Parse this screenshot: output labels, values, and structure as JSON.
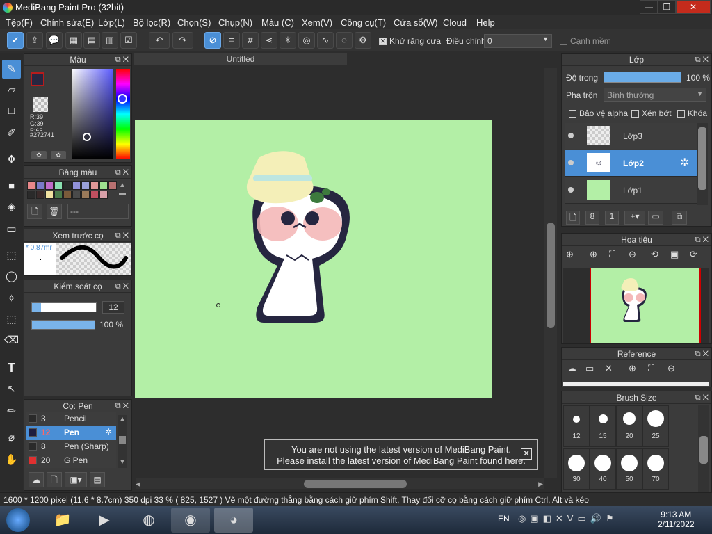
{
  "app": {
    "title": "MediBang Paint Pro (32bit)",
    "win_min": "—",
    "win_max": "❐",
    "win_close": "✕"
  },
  "menu": [
    "Tệp(F)",
    "Chỉnh sửa(E)",
    "Lớp(L)",
    "Bộ lọc(R)",
    "Chọn(S)",
    "Chụp(N)",
    "Màu (C)",
    "Xem(V)",
    "Công cụ(T)",
    "Cửa sổ(W)",
    "Cloud",
    "Help"
  ],
  "toolbar": {
    "antialias": "Khử răng cưa",
    "adjust": "Điều chỉnh",
    "adjust_value": "0",
    "soft_edge": "Cạnh mềm"
  },
  "color_panel": {
    "title": "Màu",
    "r": "R:39",
    "g": "G:39",
    "b": "B:65",
    "hex": "#272741",
    "fg": "#b71c1c",
    "bg": "#4040aa"
  },
  "palette_panel": {
    "title": "Bảng màu",
    "name": "---",
    "colors": [
      "#e8888a",
      "#7a7ac8",
      "#c06cc8",
      "#8ae0b0",
      "#2a2a2a",
      "#9090d8",
      "#9aa0d8",
      "#e09898",
      "#a0e090",
      "#b87070",
      "#2a2a2a",
      "#3a2a2a",
      "#f0e0a0",
      "#4a7a4a",
      "#7a5a3a",
      "#4a4a4a",
      "#9a7a5a",
      "#c05060",
      "#d8a0a8"
    ]
  },
  "preview_panel": {
    "title": "Xem trước cọ",
    "size": "* 0.87mr"
  },
  "brush_ctrl": {
    "title": "Kiểm soát cọ",
    "size": "12",
    "opacity": "100 %",
    "size_level": 0.14,
    "opacity_level": 1.0
  },
  "brush_panel": {
    "title": "Cọ: Pen",
    "items": [
      {
        "size": "3",
        "name": "Pencil",
        "color": "#2a2a2a"
      },
      {
        "size": "12",
        "name": "Pen",
        "color": "#1e1e40"
      },
      {
        "size": "8",
        "name": "Pen (Sharp)",
        "color": "#2a2a2a"
      },
      {
        "size": "20",
        "name": "G Pen",
        "color": "#e03030"
      }
    ]
  },
  "canvas": {
    "tab": "Untitled"
  },
  "notice": {
    "line1": "You are not using the latest version of MediBang Paint.",
    "line2": "Please install the latest version of MediBang Paint found here."
  },
  "layer_panel": {
    "title": "Lớp",
    "opacity_label": "Độ trong",
    "opacity": "100 %",
    "blend_label": "Pha trộn",
    "blend": "Bình thường",
    "protect_alpha": "Bảo vệ alpha",
    "clip": "Xén bớt",
    "lock": "Khóa",
    "layers": [
      "Lớp3",
      "Lớp2",
      "Lớp1"
    ]
  },
  "nav_panel": {
    "title": "Hoa tiêu"
  },
  "ref_panel": {
    "title": "Reference"
  },
  "brushsize_panel": {
    "title": "Brush Size",
    "sizes": [
      "12",
      "15",
      "20",
      "25",
      "30",
      "40",
      "50",
      "70"
    ]
  },
  "status": "1600 * 1200 pixel  (11.6 * 8.7cm)  350 dpi  33 %  ( 825, 1527 )  Vẽ một đường thẳng bằng cách giữ phím Shift, Thay đổi cỡ cọ bằng cách giữ phím Ctrl, Alt và kéo",
  "taskbar": {
    "lang": "EN",
    "time": "9:13 AM",
    "date": "2/11/2022"
  }
}
